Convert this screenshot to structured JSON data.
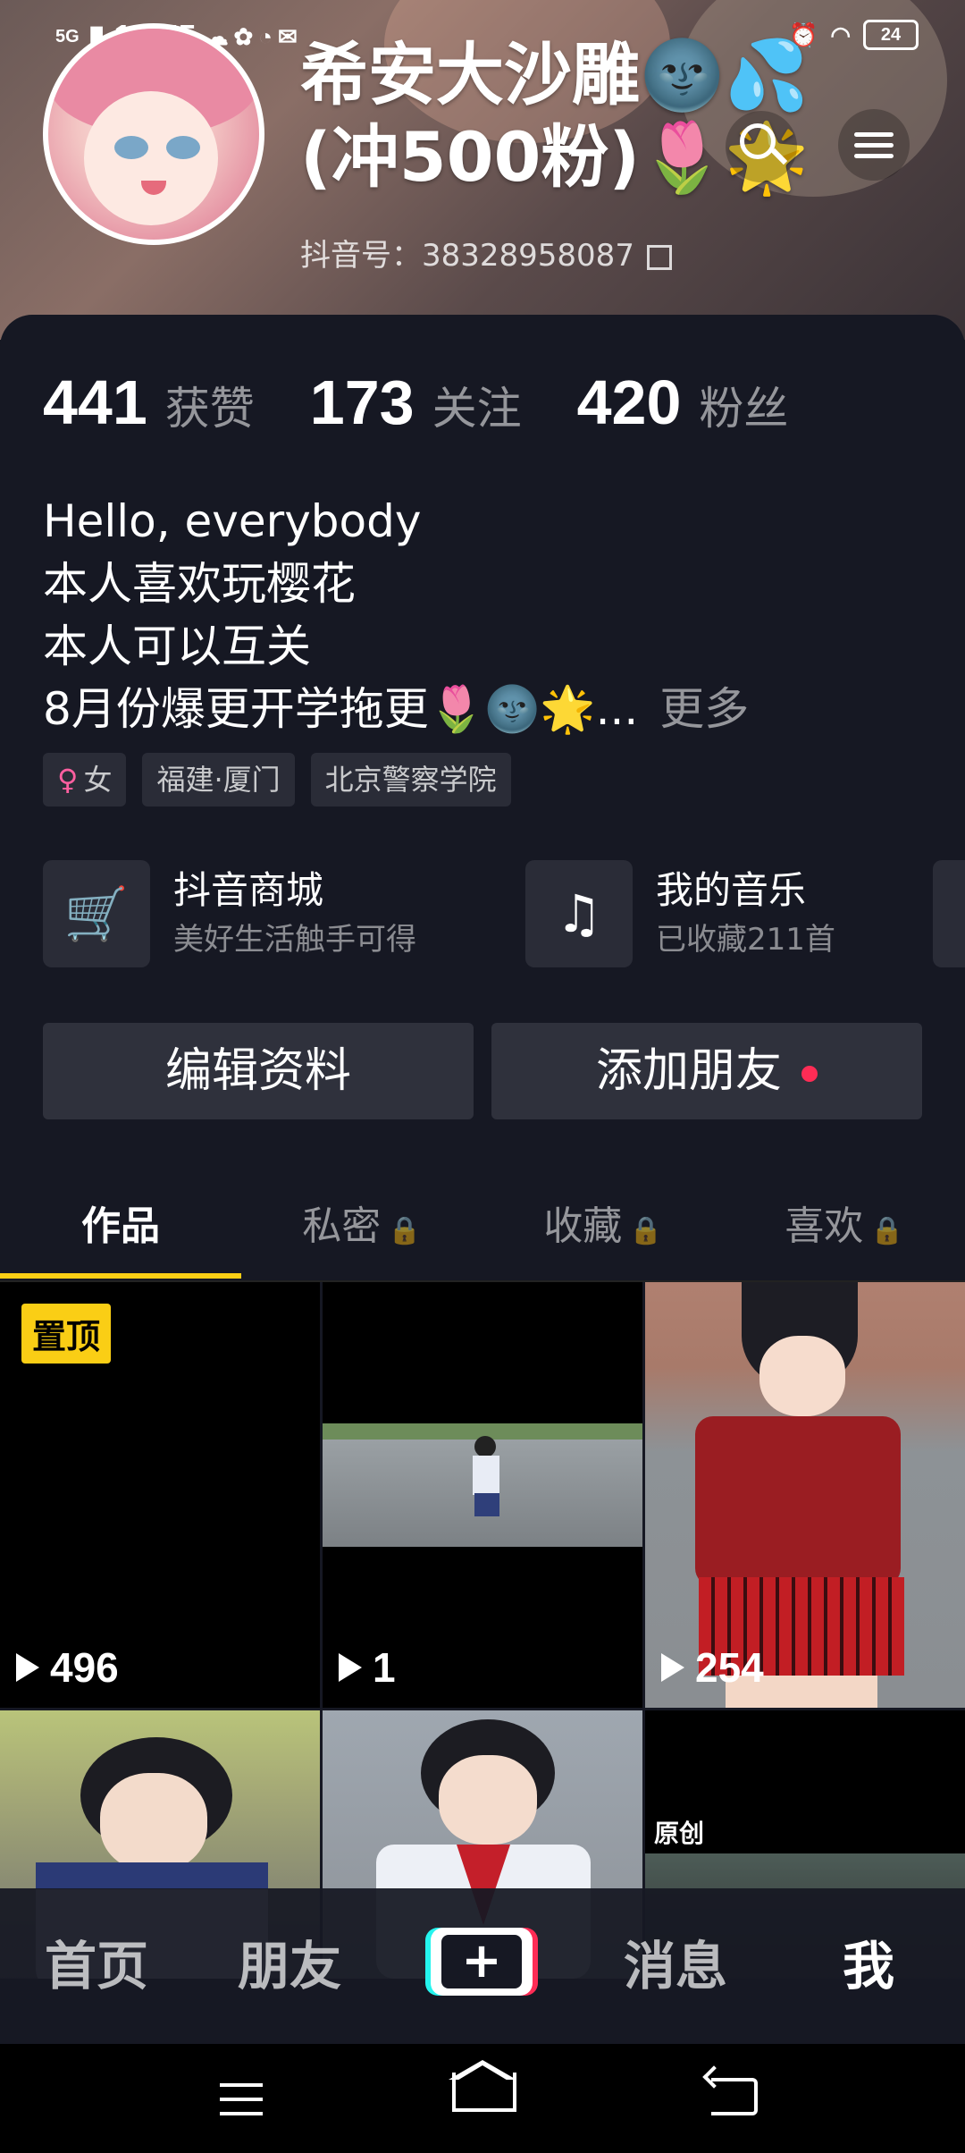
{
  "status_bar": {
    "network": "5G",
    "time": "12:55",
    "battery": "24"
  },
  "profile": {
    "nickname": "希安大沙雕🌚💦(冲500粉)🌷🌟",
    "douyin_id": "抖音号：38328958087"
  },
  "stats": [
    {
      "value": "441",
      "label": "获赞"
    },
    {
      "value": "173",
      "label": "关注"
    },
    {
      "value": "420",
      "label": "粉丝"
    }
  ],
  "bio": {
    "lines": [
      "Hello, everybody",
      "本人喜欢玩樱花",
      "本人可以互关",
      "8月份爆更开学拖更🌷🌚🌟..."
    ],
    "more": "更多"
  },
  "tags": {
    "gender": "女",
    "location": "福建·厦门",
    "school": "北京警察学院"
  },
  "services": [
    {
      "icon": "cart-icon",
      "title": "抖音商城",
      "subtitle": "美好生活触手可得"
    },
    {
      "icon": "music-icon",
      "title": "我的音乐",
      "subtitle": "已收藏211首"
    }
  ],
  "buttons": {
    "edit": "编辑资料",
    "add_friend": "添加朋友"
  },
  "tabs": [
    {
      "label": "作品",
      "locked": false
    },
    {
      "label": "私密",
      "locked": true
    },
    {
      "label": "收藏",
      "locked": true
    },
    {
      "label": "喜欢",
      "locked": true
    }
  ],
  "videos": [
    {
      "plays": "496",
      "badge": "置顶"
    },
    {
      "plays": "1",
      "badge": ""
    },
    {
      "plays": "254",
      "badge": ""
    },
    {
      "plays": "",
      "badge": ""
    },
    {
      "plays": "",
      "badge": ""
    },
    {
      "plays": "",
      "badge": "原创"
    }
  ],
  "bottom_nav": [
    "首页",
    "朋友",
    "+",
    "消息",
    "我"
  ],
  "colors": {
    "accent_yellow": "#face15",
    "accent_red": "#fe2c55",
    "accent_cyan": "#25f4ee",
    "background": "#161823"
  }
}
